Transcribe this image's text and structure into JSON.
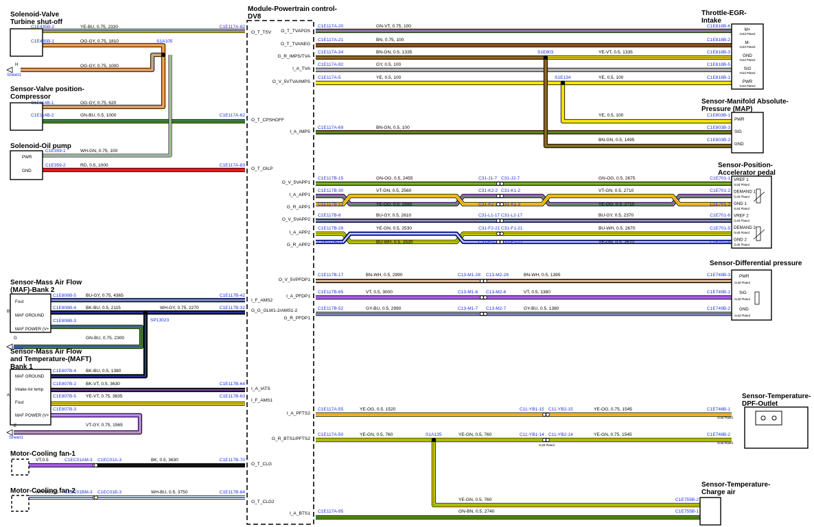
{
  "module": {
    "title": "Module-Powertrain control-DV8"
  },
  "sheet_ref": "Sheet1",
  "gold_plated": "Gold Plated",
  "colors": {
    "blue_text": "#1c2fe0",
    "conductor_outline": "#0a0a0a",
    "splice_fill": "#000000"
  },
  "components": {
    "turbine": {
      "title": [
        "Solenoid-Valve",
        "Turbine shut-off"
      ]
    },
    "compressor": {
      "title": [
        "Sensor-Valve position-",
        "Compressor"
      ]
    },
    "oilpump": {
      "title": "Solenoid-Oil pump",
      "pins": [
        "PWR",
        "GND"
      ]
    },
    "maf2": {
      "title": [
        "Sensor-Mass Air Flow",
        "(MAF)-Bank 2"
      ],
      "pins": [
        "Fout",
        "MAF GROUND",
        "MAF POWER (V+"
      ],
      "side": "B"
    },
    "maft": {
      "title": [
        "Sensor-Mass Air Flow",
        "and Temperature-(MAFT)",
        "Bank 1"
      ],
      "pins": [
        "MAF GROUND",
        "Intake Air temp",
        "Fout",
        "MAF POWER (V+"
      ],
      "side": "A"
    },
    "fan1": {
      "title": "Motor-Cooling fan-1"
    },
    "fan2": {
      "title": "Motor-Cooling fan-2"
    },
    "throttle": {
      "title": [
        "Throttle-EGR-",
        "Intake"
      ],
      "pins": [
        "M+",
        "M-",
        "GND",
        "SIG",
        "PWR"
      ]
    },
    "map": {
      "title": [
        "Sensor-Manifold Absolute-",
        "Pressure (MAP)"
      ],
      "pins": [
        "PWR",
        "SIG",
        "GND"
      ]
    },
    "pedal": {
      "title": [
        "Sensor-Position-",
        "Accelerator pedal"
      ],
      "pins": [
        "VREF 1",
        "DEMAND 1",
        "GND 1",
        "VREF 2",
        "DEMAND 2",
        "GND 2"
      ]
    },
    "diff": {
      "title": "Sensor-Differential pressure",
      "pins": [
        "PWR",
        "SIG",
        "GND"
      ]
    },
    "dpf": {
      "title": [
        "Sensor-Temperature-",
        "DPF-Outlet"
      ]
    },
    "charge": {
      "title": [
        "Sensor-Temperature-",
        "Charge air"
      ]
    }
  },
  "left_wires": [
    {
      "from": "C1E435B-2",
      "spec": "YE-BU, 0.75, 2330",
      "to": "C1E117A-82",
      "signal": "O_T_TSV"
    },
    {
      "from": "C1E435B-1",
      "spec": "OG-GY, 0.75, 1810",
      "splice": "S1A105"
    },
    {
      "ref": "H",
      "spec": "OG-GY, 0.75, 1000"
    },
    {
      "from": "C1E114B-1",
      "spec": "OG-GY, 0.75, 620"
    },
    {
      "from": "C1E114B-2",
      "spec": "GN-BU, 0.5, 1000",
      "to": "C1E117A-62",
      "signal": "O_T_CPSHOFF"
    },
    {
      "from": "C1E359-1",
      "spec": "WH-GN, 0.75, 100"
    },
    {
      "from": "C1E359-2",
      "spec": "RD, 0.5, 1000",
      "to": "C1E117A-83",
      "signal": "O_T_OILP"
    },
    {
      "from": "C1E808B-5",
      "spec": "BU-GY, 0.75, 4365",
      "to": "C1E117B-42",
      "signal": "I_F_AMS2"
    },
    {
      "from": "C1E808B-4",
      "spec": "BK-BU, 0.5, 2115",
      "splice": "SP13023",
      "spec2": "WH-GY, 0.75, 2270",
      "to": "C1E117B-32",
      "signal": "G_G_GLW1-2/AMS1-2"
    },
    {
      "from": "C1E808B-3",
      "ref": "G",
      "spec": "GN-BU, 0.75, 2300"
    },
    {
      "from": "C1E807B-4",
      "spec": "BK-BU, 0.5, 1380"
    },
    {
      "from": "C1E807B-2",
      "spec": "BK-VT, 0.5, 3630",
      "to": "C1E117B-64",
      "signal": "I_A_IATS"
    },
    {
      "from": "C1E807B-5",
      "spec": "YE-VT, 0.75, 3635",
      "to": "C1E117B-63",
      "signal": "I_F_AMS1"
    },
    {
      "from": "C1E807B-3",
      "ref": "E",
      "spec": "VT-GY, 0.75, 1565"
    },
    {
      "spec": "VT,0.5",
      "inline": "C1EC01AM-3",
      "inline2": "C1EC01A-3",
      "spec2": "BK, 0.5, 3630",
      "to": "C1E117B-70",
      "signal": "O_T_CLG"
    },
    {
      "spec": "WH-BU,0.5",
      "inline": "C1EC01BM-3",
      "inline2": "C1EC01B-3",
      "spec2": "WH-BU, 0.5, 3750",
      "to": "C1E117B-84",
      "signal": "O_T_CLG2"
    }
  ],
  "right_wires": [
    {
      "signal": "O_T_TVAPOS",
      "from": "C1E117A-20",
      "spec": "GN-VT, 0.75, 100",
      "to": "C1E818B-6"
    },
    {
      "signal": "O_T_TVANEG",
      "from": "C1E117A-21",
      "spec": "BN, 0.75, 100",
      "to": "C1E818B-2"
    },
    {
      "signal": "G_R_IMPS/TVA",
      "from": "C1E117A-34",
      "spec": "BN-GN, 0.5, 1335",
      "splice": "S1E803",
      "spec2": "YE-VT, 0.5, 1335",
      "to": "C1E818B-3"
    },
    {
      "signal": "I_A_TVA",
      "from": "C1E117A-92",
      "spec": "GY, 0.5, 100",
      "to": "C1E818B-5"
    },
    {
      "signal": "O_V_5VTVA/IMPS",
      "from": "C1E117A-5",
      "spec": "YE, 0.5, 100",
      "splice": "S1E134",
      "spec2": "YE, 0.5, 100",
      "to": "C1E818B-1"
    },
    {
      "spec": "YE, 0.5, 100",
      "to": "C1E803B-1"
    },
    {
      "signal": "I_A_IMPS",
      "from": "C1E117A-69",
      "spec": "BN-GN, 0.5, 100",
      "to": "C1E803B-3"
    },
    {
      "spec": "BN-GN, 0.5, 1495",
      "to": "C1E803B-2"
    },
    {
      "signal": "O_V_5VAPP1",
      "from": "C1E117B-15",
      "spec": "GN-OG, 0.5, 2455",
      "inline": "C31-J1-7",
      "inline2": "C31-J2-7",
      "spec2": "GN-OG, 0.5, 2675",
      "to": "C1E701-1"
    },
    {
      "signal": "I_A_APP1",
      "from": "C1E117B-30",
      "spec": "VT-GN, 0.5, 2560",
      "inline": "C31-K2-2",
      "inline2": "C31-K1-2",
      "spec2": "VT-GN, 0.5, 2710",
      "to": "C1E701-2"
    },
    {
      "signal": "G_R_APP1",
      "from": "C1E117B-13",
      "spec": "YE-OG, 0.5, 2560",
      "inline": "C31-K2-3",
      "inline2": "C31-K1-3",
      "spec2": "YE-OG, 0.5, 2710",
      "to": "C1E701-3"
    },
    {
      "signal": "O_V_5VAPP2",
      "from": "C1E117B-8",
      "spec": "BU-GY, 0.5, 2610",
      "inline": "C31-L1-17",
      "inline2": "C31-L2-17",
      "spec2": "BU-GY, 0.5, 2370",
      "to": "C1E701-6"
    },
    {
      "signal": "I_A_APP2",
      "from": "C1E117B-29",
      "spec": "YE-GN, 0.5, 2530",
      "inline": "C31-F2-21",
      "inline2": "C31-F1-21",
      "spec2": "BU-WH, 0.5, 2670",
      "to": "C1E701-5"
    },
    {
      "signal": "G_R_APP2",
      "from": "C1E117B-12",
      "spec": "BU-WH, 0.5, 2530",
      "inline": "C31-F2-22",
      "inline2": "C31-F1-22",
      "spec2": "YE-GN, 0.5, 2670",
      "to": "C1E701-4"
    },
    {
      "signal": "O_V_5VPFDP1",
      "from": "C1E117B-17",
      "spec": "BN-WH, 0.5, 2990",
      "inline": "C13-M1-28",
      "inline2": "C13-M2-28",
      "spec2": "BN-WH, 0.5, 1395",
      "to": "C1E749B-3"
    },
    {
      "signal": "I_A_PFDP1",
      "from": "C1E117B-65",
      "spec": "VT, 0.5, 3000",
      "inline": "C13-M1-6",
      "inline2": "C13-M2-6",
      "spec2": "VT, 0.5, 1380",
      "to": "C1E749B-1"
    },
    {
      "signal": "G_R_PFDP1",
      "from": "C1E117B-52",
      "spec": "GY-BU, 0.5, 2990",
      "inline": "C13-M1-7",
      "inline2": "C13-M2-7",
      "spec2": "GY-BU, 0.5, 1380",
      "to": "C1E749B-2"
    },
    {
      "signal": "I_A_PFTS2",
      "from": "C1E117A-55",
      "spec": "YE-OG, 0.5, 1520",
      "inline": "C11-YB1-15",
      "inline2": "C11-YB2-15",
      "spec2": "YE-OG, 0.75, 1545",
      "to": "C1E748B-1"
    },
    {
      "signal": "G_R_BTS1/PFTS2",
      "from": "C1E117A-50",
      "spec": "YE-GN, 0.5, 760",
      "splice": "S1A135",
      "spec_mid": "YE-GN, 0.5, 760",
      "inline": "C11-YB1-14",
      "inline2": "C11-YB2-14",
      "spec2": "YE-GN, 0.75, 1545",
      "to": "C1E748B-2"
    },
    {
      "spec": "YE-GN, 0.5, 760",
      "to": "C1E755B-2"
    },
    {
      "signal": "I_A_BTS1",
      "from": "C1E117A-95",
      "spec": "GN-BN, 0.5, 2740",
      "to": "C1E755B-1"
    }
  ]
}
